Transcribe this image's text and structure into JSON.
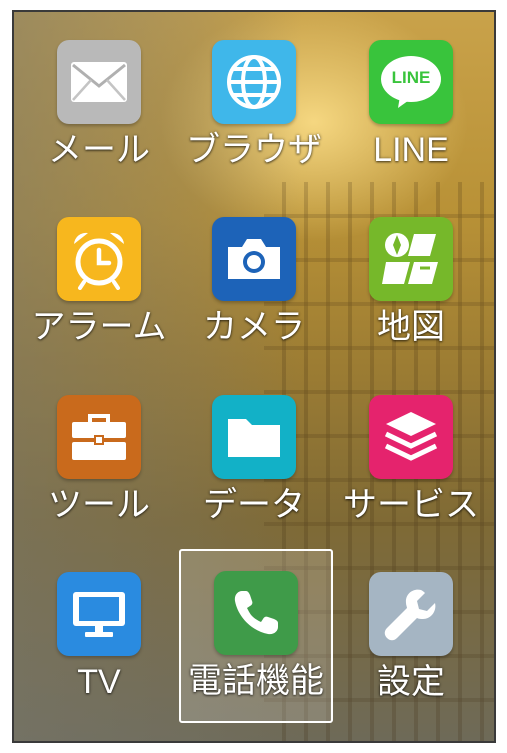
{
  "apps": [
    {
      "label": "メール",
      "icon": "mail-icon",
      "color": "#b9b9b9"
    },
    {
      "label": "ブラウザ",
      "icon": "globe-icon",
      "color": "#3fb7ea"
    },
    {
      "label": "LINE",
      "icon": "line-icon",
      "color": "#39c43c"
    },
    {
      "label": "アラーム",
      "icon": "alarm-clock-icon",
      "color": "#f7b71e"
    },
    {
      "label": "カメラ",
      "icon": "camera-icon",
      "color": "#1d63b8"
    },
    {
      "label": "地図",
      "icon": "map-icon",
      "color": "#76b82a"
    },
    {
      "label": "ツール",
      "icon": "toolbox-icon",
      "color": "#c96a1c"
    },
    {
      "label": "データ",
      "icon": "folder-icon",
      "color": "#12b1c7"
    },
    {
      "label": "サービス",
      "icon": "layers-icon",
      "color": "#e5236d"
    },
    {
      "label": "TV",
      "icon": "tv-icon",
      "color": "#2a8be0"
    },
    {
      "label": "電話機能",
      "icon": "phone-icon",
      "color": "#3f9b49",
      "focused": true
    },
    {
      "label": "設定",
      "icon": "wrench-icon",
      "color": "#a5b5c3"
    }
  ],
  "line_icon_text": "LINE"
}
